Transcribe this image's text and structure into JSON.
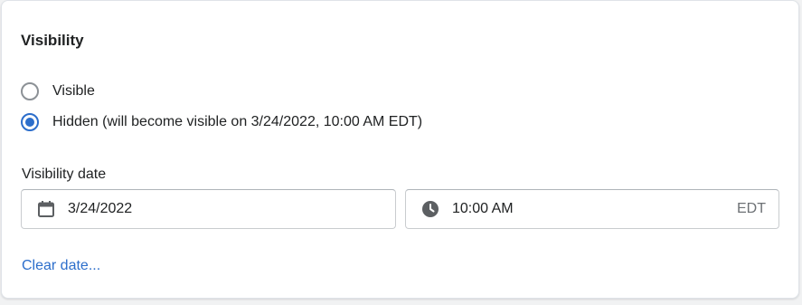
{
  "section": {
    "title": "Visibility"
  },
  "options": [
    {
      "label": "Visible",
      "checked": false
    },
    {
      "label": "Hidden (will become visible on 3/24/2022, 10:00 AM EDT)",
      "checked": true
    }
  ],
  "visibility_date": {
    "label": "Visibility date",
    "date_value": "3/24/2022",
    "date_icon": "calendar-icon",
    "time_value": "10:00 AM",
    "time_icon": "clock-icon",
    "timezone": "EDT"
  },
  "clear_link": "Clear date...",
  "colors": {
    "accent": "#2c6ecb",
    "text": "#202223",
    "muted": "#6d7175"
  }
}
